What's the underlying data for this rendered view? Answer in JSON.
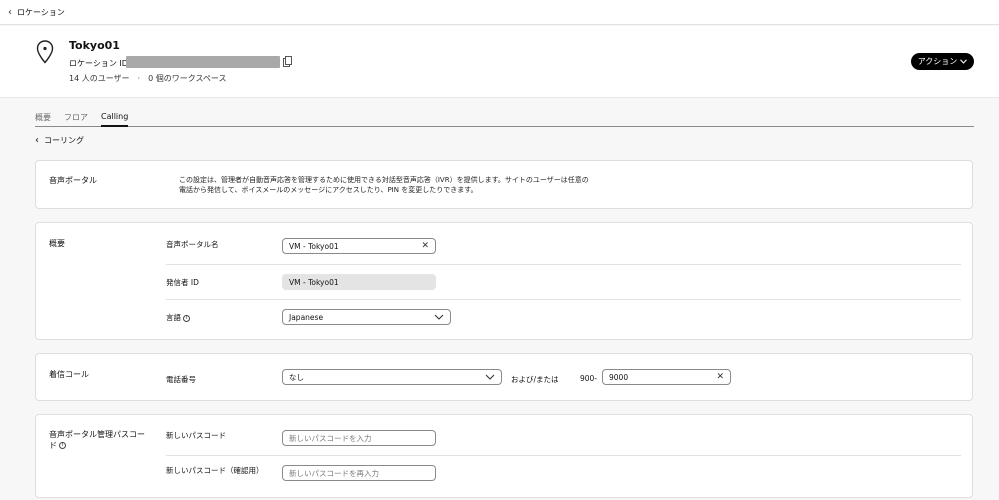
{
  "topbar": {
    "back_label": "ロケーション"
  },
  "header": {
    "title": "Tokyo01",
    "location_id_label": "ロケーション ID:",
    "meta": "14 人のユーザー　·　0 個のワークスペース",
    "action_label": "アクション"
  },
  "tabs": [
    {
      "label": "概要"
    },
    {
      "label": "フロア"
    },
    {
      "label": "Calling"
    }
  ],
  "back_link": {
    "label": "コーリング"
  },
  "voice_portal": {
    "title": "音声ポータル",
    "description": "この設定は、管理者が自動音声応答を管理するために使用できる対話型音声応答（IVR）を提供します。サイトのユーザーは任意の電話から発信して、ボイスメールのメッセージにアクセスしたり、PIN を変更したりできます。"
  },
  "overview": {
    "title": "概要",
    "portal_name_label": "音声ポータル名",
    "portal_name_value": "VM - Tokyo01",
    "caller_id_label": "発信者 ID",
    "caller_id_value": "VM - Tokyo01",
    "language_label": "言語",
    "language_value": "Japanese"
  },
  "incoming": {
    "title": "着信コール",
    "phone_label": "電話番号",
    "phone_value": "なし",
    "andor_label": "および/または",
    "prefix": "900-",
    "extension_value": "9000"
  },
  "passcode": {
    "title": "音声ポータル管理パスコード",
    "new_label": "新しいパスコード",
    "new_placeholder": "新しいパスコードを入力",
    "confirm_label": "新しいパスコード（確認用）",
    "confirm_placeholder": "新しいパスコードを再入力"
  }
}
